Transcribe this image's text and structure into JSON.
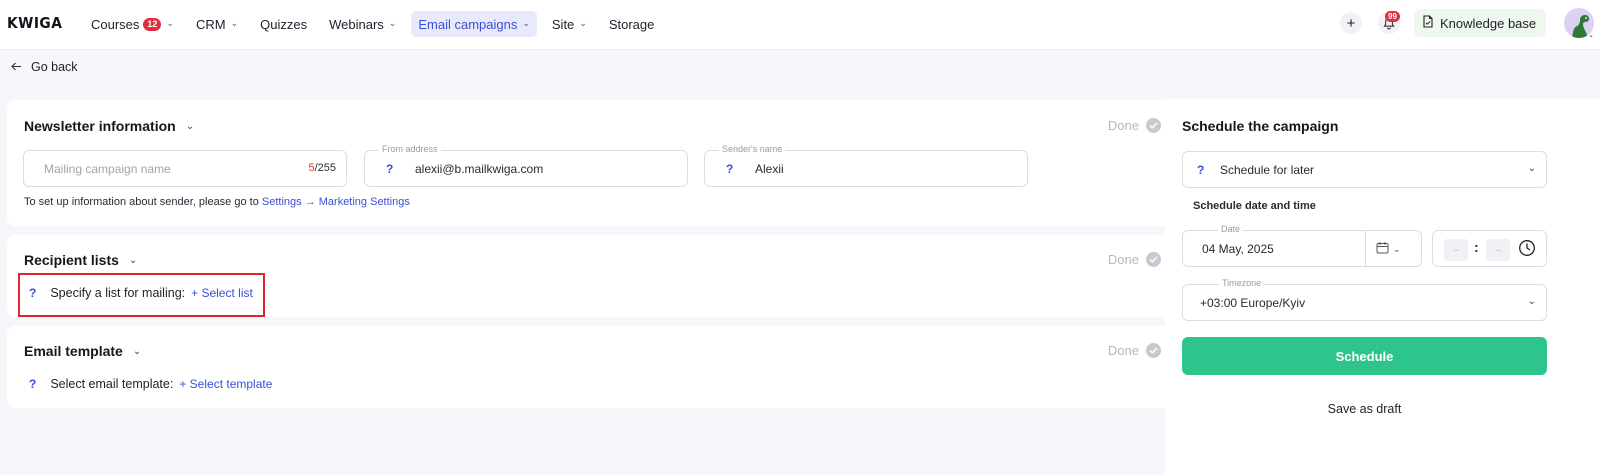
{
  "app": {
    "logo": "KWIGA"
  },
  "nav": {
    "items": [
      {
        "label": "Courses",
        "badge": "12",
        "has_dropdown": true,
        "active": false
      },
      {
        "label": "CRM",
        "badge": null,
        "has_dropdown": true,
        "active": false
      },
      {
        "label": "Quizzes",
        "badge": null,
        "has_dropdown": false,
        "active": false
      },
      {
        "label": "Webinars",
        "badge": null,
        "has_dropdown": true,
        "active": false
      },
      {
        "label": "Email campaigns",
        "badge": null,
        "has_dropdown": true,
        "active": true
      },
      {
        "label": "Site",
        "badge": null,
        "has_dropdown": true,
        "active": false
      },
      {
        "label": "Storage",
        "badge": null,
        "has_dropdown": false,
        "active": false
      }
    ]
  },
  "topbar": {
    "plus_icon": "plus-icon",
    "bell_icon": "bell-icon",
    "notifications_count": "99",
    "knowledge_base_label": "Knowledge base",
    "knowledge_base_icon": "document-icon",
    "avatar_icon": "dinosaur-avatar"
  },
  "go_back": {
    "label": "Go back",
    "icon": "arrow-left-icon"
  },
  "newsletter": {
    "title": "Newsletter information",
    "done_label": "Done",
    "campaign_name": {
      "placeholder": "Mailing campaign name",
      "counter_current": "5",
      "counter_max": "/255"
    },
    "from_address": {
      "label": "From address",
      "value": "alexii@b.mailkwiga.com"
    },
    "sender_name": {
      "label": "Sender's name",
      "value": "Alexii"
    },
    "helper_text": "To set up information about sender, please go to ",
    "helper_link": "Settings → Marketing Settings"
  },
  "recipients": {
    "title": "Recipient lists",
    "done_label": "Done",
    "prompt": "Specify a list for mailing:",
    "link": "+ Select list"
  },
  "template": {
    "title": "Email template",
    "done_label": "Done",
    "prompt": "Select email template:",
    "link": "+ Select template"
  },
  "schedule": {
    "title": "Schedule the campaign",
    "mode": "Schedule for later",
    "date_time_label": "Schedule date and time",
    "date_label": "Date",
    "date_value": "04 May, 2025",
    "hour_placeholder": "--",
    "minute_placeholder": "--",
    "timezone_label": "Timezone",
    "timezone_value": "+03:00 Europe/Kyiv",
    "schedule_button": "Schedule",
    "draft_button": "Save as draft"
  },
  "colors": {
    "accent": "#3a4fd8",
    "nav_active_bg": "#e8eafc",
    "badge": "#e0303e",
    "primary_button": "#2ec58c",
    "highlight_box": "#e0252b",
    "done_gray": "#b7b7c0"
  }
}
